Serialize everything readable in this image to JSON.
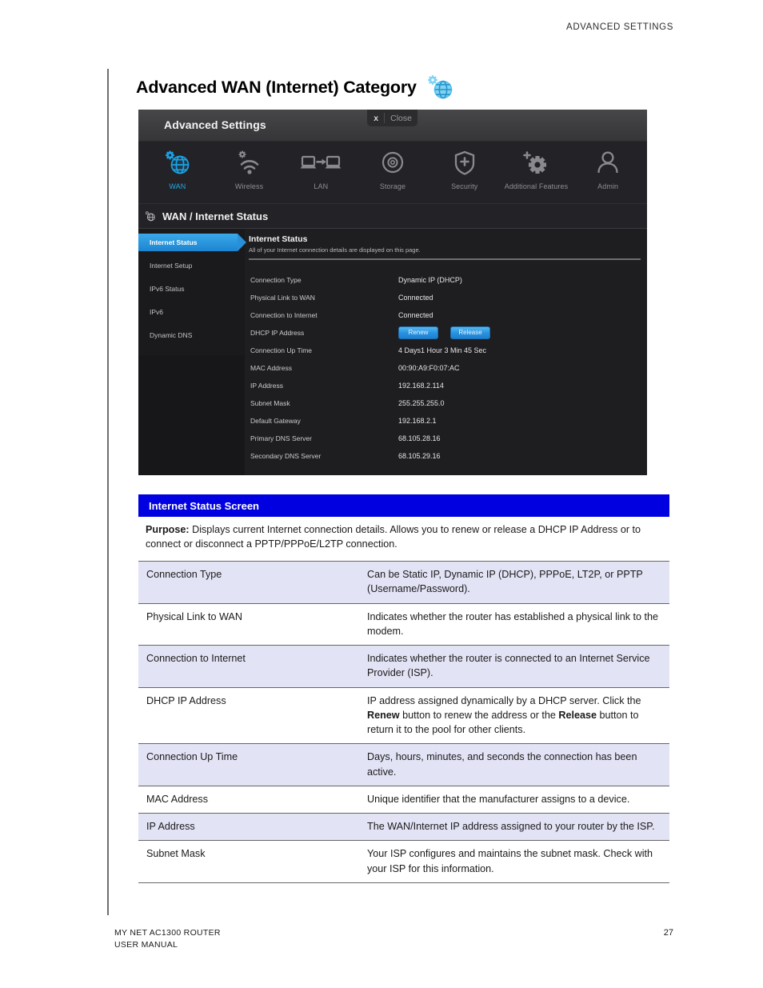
{
  "running_head": "ADVANCED SETTINGS",
  "page_title": "Advanced WAN (Internet) Category",
  "ui": {
    "window_title": "Advanced Settings",
    "close_x": "x",
    "close_label": "Close",
    "nav": [
      {
        "label": "WAN",
        "icon": "globe-gear-icon",
        "active": true
      },
      {
        "label": "Wireless",
        "icon": "wifi-gear-icon",
        "active": false
      },
      {
        "label": "LAN",
        "icon": "two-laptops-arrow-icon",
        "active": false
      },
      {
        "label": "Storage",
        "icon": "disc-icon",
        "active": false
      },
      {
        "label": "Security",
        "icon": "shield-plus-icon",
        "active": false
      },
      {
        "label": "Additional Features",
        "icon": "gear-plus-icon",
        "active": false
      },
      {
        "label": "Admin",
        "icon": "person-icon",
        "active": false
      }
    ],
    "section_title": "WAN / Internet Status",
    "sidebar": [
      {
        "label": "Internet Status",
        "active": true
      },
      {
        "label": "Internet Setup",
        "active": false
      },
      {
        "label": "IPv6 Status",
        "active": false
      },
      {
        "label": "IPv6",
        "active": false
      },
      {
        "label": "Dynamic DNS",
        "active": false
      }
    ],
    "content_title": "Internet Status",
    "content_sub": "All of your Internet connection details are displayed on this page.",
    "rows": [
      {
        "key": "Connection Type",
        "value": "Dynamic IP (DHCP)"
      },
      {
        "key": "Physical Link to WAN",
        "value": "Connected"
      },
      {
        "key": "Connection to Internet",
        "value": "Connected"
      },
      {
        "key": "DHCP IP Address",
        "value": "",
        "buttons": [
          "Renew",
          "Release"
        ]
      },
      {
        "key": "Connection Up Time",
        "value": "4 Days1 Hour 3 Min 45 Sec"
      },
      {
        "key": "MAC Address",
        "value": "00:90:A9:F0:07:AC"
      },
      {
        "key": "IP Address",
        "value": "192.168.2.114"
      },
      {
        "key": "Subnet Mask",
        "value": "255.255.255.0"
      },
      {
        "key": "Default Gateway",
        "value": "192.168.2.1"
      },
      {
        "key": "Primary DNS Server",
        "value": "68.105.28.16"
      },
      {
        "key": "Secondary DNS Server",
        "value": "68.105.29.16"
      }
    ],
    "btn_renew": "Renew",
    "btn_release": "Release"
  },
  "banner_title": "Internet Status Screen",
  "purpose_label": "Purpose:",
  "purpose_text": " Displays current Internet connection details. Allows you to renew or release a DHCP IP Address or to connect or disconnect a PPTP/PPPoE/L2TP connection.",
  "definitions": [
    {
      "term": "Connection Type",
      "desc": "Can be Static IP, Dynamic IP (DHCP), PPPoE, LT2P, or PPTP (Username/Password).",
      "shade": true
    },
    {
      "term": "Physical Link to WAN",
      "desc": "Indicates whether the router has established a physical link to the modem.",
      "shade": false
    },
    {
      "term": "Connection to Internet",
      "desc": "Indicates whether the router is connected to an Internet Service Provider (ISP).",
      "shade": true
    },
    {
      "term": "DHCP IP Address",
      "desc_parts": [
        {
          "t": "IP address assigned dynamically by a DHCP server. Click the ",
          "b": false
        },
        {
          "t": "Renew",
          "b": true
        },
        {
          "t": " button to renew the address or the ",
          "b": false
        },
        {
          "t": "Release",
          "b": true
        },
        {
          "t": " button to return it to the pool for other clients.",
          "b": false
        }
      ],
      "shade": false
    },
    {
      "term": "Connection Up Time",
      "desc": "Days, hours, minutes, and seconds the connection has been active.",
      "shade": true
    },
    {
      "term": "MAC Address",
      "desc": "Unique identifier that the manufacturer assigns to a device.",
      "shade": false
    },
    {
      "term": "IP Address",
      "desc": "The WAN/Internet IP address assigned to your router by the ISP.",
      "shade": true
    },
    {
      "term": "Subnet Mask",
      "desc": "Your ISP configures and maintains the subnet mask. Check with your ISP for this information.",
      "shade": false
    }
  ],
  "footer": {
    "line1": "MY NET AC1300 ROUTER",
    "line2": "USER MANUAL",
    "page_number": "27"
  },
  "colors": {
    "accent_blue": "#23a8e8",
    "banner_blue": "#0000e0",
    "row_shade": "#e3e3f6"
  }
}
